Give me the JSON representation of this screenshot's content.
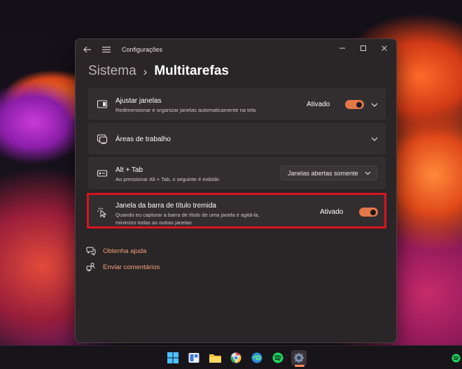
{
  "window": {
    "app_title": "Configurações"
  },
  "breadcrumb": {
    "parent": "Sistema",
    "separator": "›",
    "current": "Multitarefas"
  },
  "settings": {
    "snap": {
      "title": "Ajustar janelas",
      "subtitle": "Redimensionar e organizar janelas automaticamente na tela",
      "state": "Ativado",
      "toggle_on": true
    },
    "desktops": {
      "title": "Áreas de trabalho"
    },
    "alttab": {
      "title": "Alt + Tab",
      "subtitle": "Ao pressionar Alt + Tab, o seguinte é exibido",
      "dropdown_value": "Janelas abertas somente"
    },
    "shake": {
      "title": "Janela da barra de título tremida",
      "subtitle_line1": "Quando eu capturar a barra de título de uma janela e agitá-la,",
      "subtitle_line2": "minimizo todas as outras janelas",
      "state": "Ativado",
      "toggle_on": true
    }
  },
  "links": {
    "help": "Obtenha ajuda",
    "feedback": "Enviar comentários"
  },
  "taskbar": {
    "items": [
      "windows-start-icon",
      "widgets-icon",
      "file-explorer-icon",
      "chrome-icon",
      "edge-icon",
      "spotify-icon",
      "settings-icon"
    ],
    "tray": [
      "spotify-tray-icon"
    ]
  },
  "colors": {
    "accent": "#e2774a",
    "link": "#f0a27a",
    "highlight": "#d8141c",
    "window_bg": "#2a2527",
    "card_bg": "#322d2f"
  }
}
